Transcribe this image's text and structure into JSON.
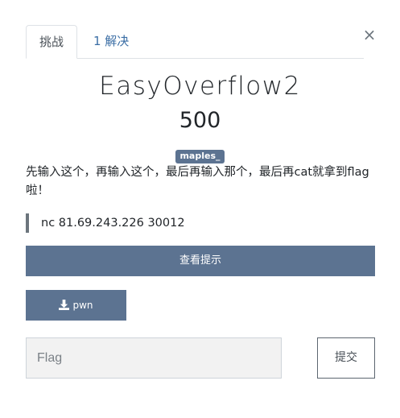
{
  "tabs": [
    {
      "label": "挑战"
    },
    {
      "label": "1 解决"
    }
  ],
  "close_glyph": "×",
  "challenge": {
    "name": "EasyOverflow2",
    "value": "500",
    "tag": "maples_",
    "description": "先输入这个，再输入这个，最后再输入那个，最后再cat就拿到flag啦！",
    "connection": "nc 81.69.243.226 30012"
  },
  "hint_button": {
    "label": "查看提示"
  },
  "file_button": {
    "label": "pwn",
    "icon": "download-icon"
  },
  "flag_input": {
    "placeholder": "Flag",
    "value": ""
  },
  "submit_button": {
    "label": "提交"
  },
  "colors": {
    "accent": "#5c7391",
    "link": "#3b6ea5",
    "input_bg": "#f2f2f2"
  }
}
